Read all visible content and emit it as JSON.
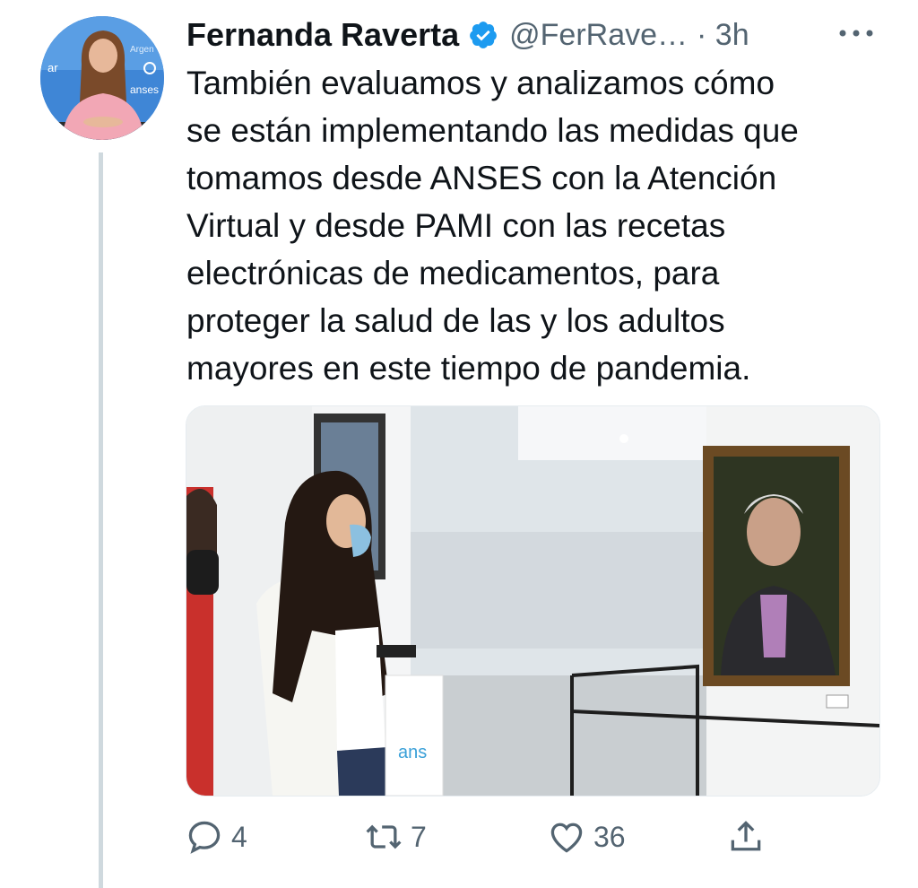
{
  "author": {
    "name": "Fernanda Raverta",
    "handle": "@FerRave…",
    "time": "· 3h",
    "avatar_text_1": "ar",
    "avatar_text_2": "anses",
    "avatar_text_3": "Argen"
  },
  "tweet": {
    "text_lines": [
      "También evaluamos y analizamos cómo",
      "se están implementando las medidas que",
      "tomamos desde ANSES con la Atención",
      "Virtual y desde PAMI con las recetas",
      "electrónicas de medicamentos, para",
      "proteger la salud de las y los adultos",
      "mayores en este tiempo de pandemia."
    ]
  },
  "media": {
    "bag_text": "ans"
  },
  "actions": {
    "reply_count": "4",
    "retweet_count": "7",
    "like_count": "36"
  },
  "colors": {
    "verified": "#1d9bf0",
    "secondary_text": "#536471",
    "thread_line": "#cfd9de"
  },
  "icons": [
    "verified-icon",
    "more-icon",
    "reply-icon",
    "retweet-icon",
    "like-icon",
    "share-icon"
  ]
}
